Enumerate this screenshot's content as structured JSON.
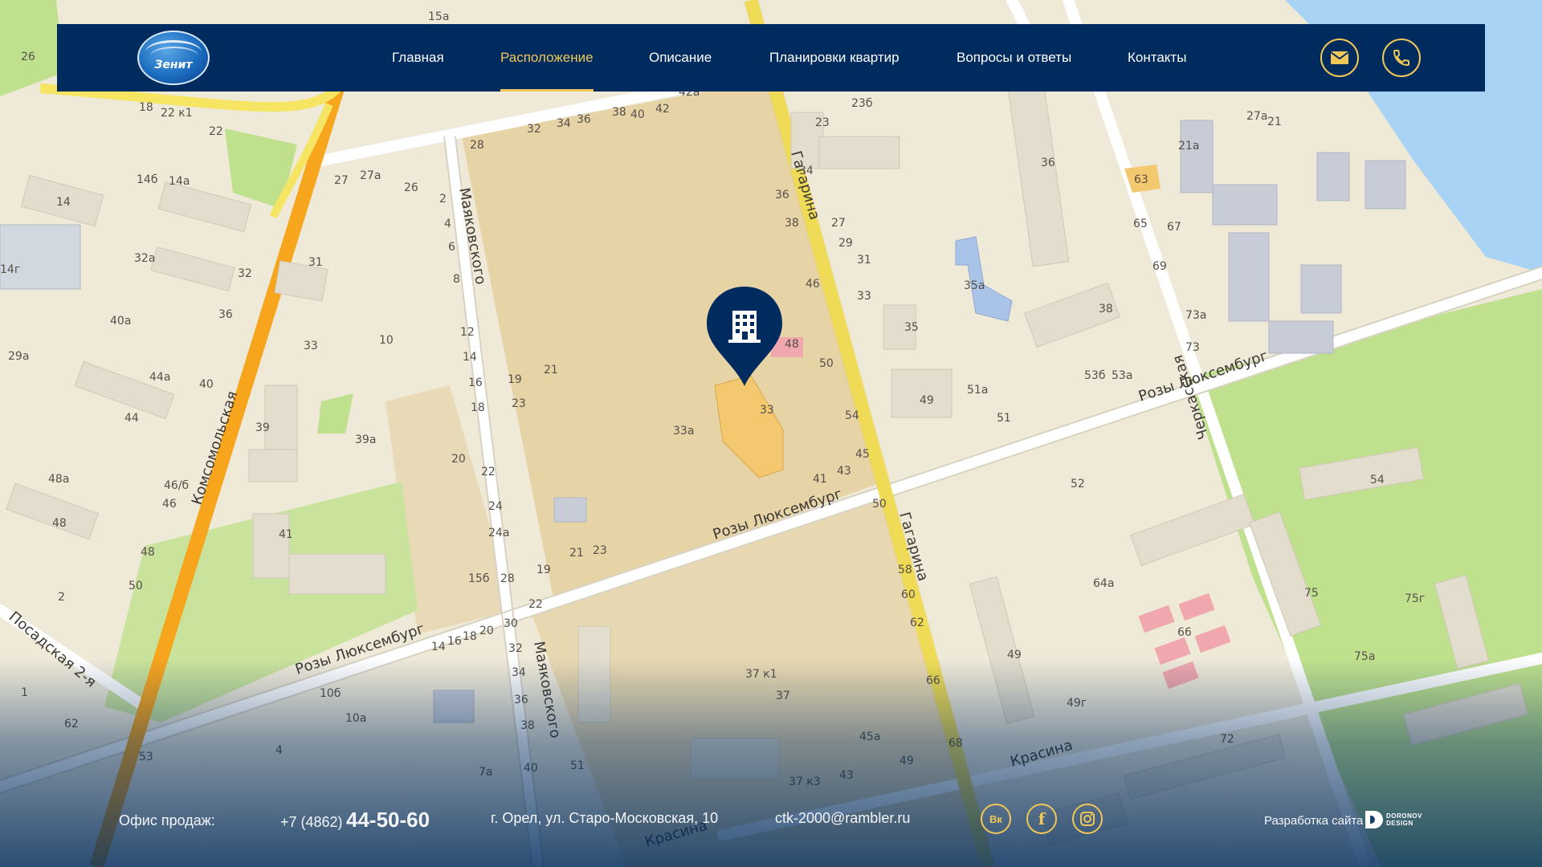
{
  "brand": {
    "logo_text": "Зенит"
  },
  "nav": {
    "items": [
      {
        "label": "Главная",
        "active": false
      },
      {
        "label": "Расположение",
        "active": true
      },
      {
        "label": "Описание",
        "active": false
      },
      {
        "label": "Планировки квартир",
        "active": false
      },
      {
        "label": "Вопросы и ответы",
        "active": false
      },
      {
        "label": "Контакты",
        "active": false
      }
    ],
    "icons": [
      "mail-icon",
      "phone-icon"
    ]
  },
  "map": {
    "streets": [
      "Розы Люксембург",
      "Гагарина",
      "Маяковского",
      "Комсомольская",
      "Черкасская",
      "Красина",
      "Посадская 2-я"
    ],
    "house_numbers": [
      "33",
      "33а",
      "48",
      "50",
      "46",
      "54",
      "45",
      "43",
      "41",
      "21",
      "23",
      "19",
      "35",
      "35а",
      "49",
      "51",
      "51а",
      "52",
      "54",
      "38",
      "36",
      "63",
      "65",
      "67",
      "69",
      "73",
      "73а",
      "64а",
      "66",
      "75",
      "75г",
      "75а",
      "72",
      "49",
      "49г",
      "37 к1",
      "37",
      "37 к3",
      "45а",
      "28",
      "32",
      "34",
      "36",
      "38",
      "40",
      "42",
      "2",
      "4",
      "6",
      "8",
      "12",
      "14",
      "16",
      "18",
      "20",
      "22",
      "24",
      "24а",
      "15б",
      "30",
      "58",
      "60",
      "62",
      "66",
      "68",
      "14",
      "22",
      "32а",
      "31",
      "44",
      "48",
      "50",
      "62",
      "53",
      "26",
      "29а",
      "40а",
      "44а",
      "39",
      "39а",
      "41",
      "46/6",
      "48а",
      "10б",
      "10а",
      "15а",
      "21а",
      "27а",
      "21",
      "23б",
      "42а",
      "26",
      "27"
    ],
    "accent_road": "#f7a51d",
    "yellow_road": "#f6e562",
    "park": "#bfe08d",
    "water": "#a9d3f5"
  },
  "footer": {
    "office_label": "Офис продаж:",
    "phone_code": "+7 (4862)",
    "phone_number": "44-50-60",
    "address": "г. Орел, ул. Старо-Московская, 10",
    "email": "ctk-2000@rambler.ru",
    "socials": [
      {
        "label": "Вк",
        "icon": "vk-icon"
      },
      {
        "label": "f",
        "icon": "facebook-icon"
      },
      {
        "label": "instagram",
        "icon": "instagram-icon"
      }
    ],
    "dev_text": "Разработка сайта -",
    "dev_logo_line1": "DORONOV",
    "dev_logo_line2": "DESIGN"
  },
  "colors": {
    "navbar_bg": "#002b5e",
    "accent": "#f1c757"
  }
}
